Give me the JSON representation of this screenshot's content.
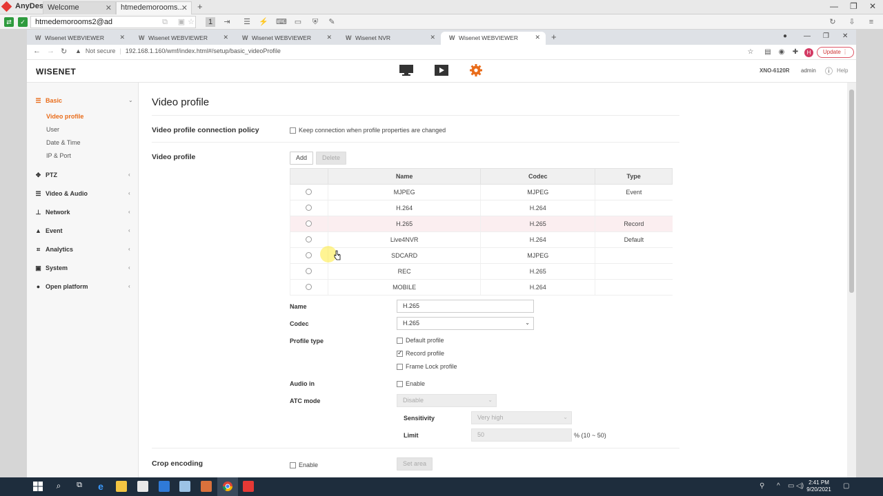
{
  "anydesk": {
    "app_name": "AnyDesk",
    "tabs": [
      "Welcome",
      "htmedemorooms..."
    ],
    "address": "htmedemorooms2@ad",
    "toolbar_monitor_label": "1"
  },
  "browser": {
    "tabs": [
      "Wisenet WEBVIEWER",
      "Wisenet WEBVIEWER",
      "Wisenet WEBVIEWER",
      "Wisenet NVR",
      "Wisenet WEBVIEWER"
    ],
    "security_label": "Not secure",
    "url": "192.168.1.160/wmf/index.html#/setup/basic_videoProfile",
    "avatar_letter": "H",
    "update_label": "Update"
  },
  "header": {
    "logo": "WISENET",
    "model": "XNO-6120R",
    "user": "admin",
    "help": "Help"
  },
  "sidebar": {
    "basic": "Basic",
    "basic_items": [
      "Video profile",
      "User",
      "Date & Time",
      "IP & Port"
    ],
    "items": [
      "PTZ",
      "Video & Audio",
      "Network",
      "Event",
      "Analytics",
      "System",
      "Open platform"
    ]
  },
  "page": {
    "title": "Video profile",
    "policy_label": "Video profile connection policy",
    "policy_checkbox": "Keep connection when profile properties are changed",
    "profile_label": "Video profile",
    "add": "Add",
    "delete": "Delete",
    "table_headers": [
      "Name",
      "Codec",
      "Type"
    ],
    "rows": [
      {
        "name": "MJPEG",
        "codec": "MJPEG",
        "type": "Event"
      },
      {
        "name": "H.264",
        "codec": "H.264",
        "type": ""
      },
      {
        "name": "H.265",
        "codec": "H.265",
        "type": "Record"
      },
      {
        "name": "Live4NVR",
        "codec": "H.264",
        "type": "Default"
      },
      {
        "name": "SDCARD",
        "codec": "MJPEG",
        "type": ""
      },
      {
        "name": "REC",
        "codec": "H.265",
        "type": ""
      },
      {
        "name": "MOBILE",
        "codec": "H.264",
        "type": ""
      }
    ],
    "name_label": "Name",
    "name_value": "H.265",
    "codec_label": "Codec",
    "codec_value": "H.265",
    "profile_type_label": "Profile type",
    "profile_types": [
      "Default profile",
      "Record profile",
      "Frame Lock profile"
    ],
    "audio_in_label": "Audio in",
    "enable": "Enable",
    "atc_mode_label": "ATC mode",
    "atc_mode_value": "Disable",
    "sensitivity_label": "Sensitivity",
    "sensitivity_value": "Very high",
    "limit_label": "Limit",
    "limit_value": "50",
    "limit_hint": "% (10 ~ 50)",
    "crop_label": "Crop encoding",
    "crop_enable": "Enable",
    "set_area": "Set area"
  },
  "taskbar": {
    "time": "2:41 PM",
    "date": "9/20/2021"
  },
  "colors": {
    "accent": "#e96c1a",
    "selected_row": "#fbeef0",
    "taskbar": "#1e2d3d"
  }
}
